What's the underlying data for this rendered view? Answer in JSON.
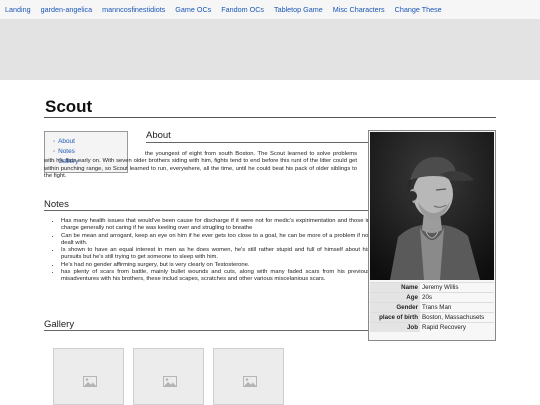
{
  "nav": {
    "links": [
      "Landing",
      "garden-angelica",
      "manncosfinestidiots",
      "Game OCs",
      "Fandom OCs",
      "Tabletop Game",
      "Misc Characters",
      "Change These"
    ]
  },
  "page": {
    "title": "Scout"
  },
  "toc": {
    "items": [
      "About",
      "Notes",
      "Gallery"
    ]
  },
  "about": {
    "heading": "About",
    "text": "the youngest of eight from south Boston. The Scout learned to solve problems with his fists early on. With seven older brothers siding with him, fights tend to end before this runt of the litter could get within punching range, so Scout learned to run, everywhere, all the time, until he could beat his pack of older siblings to the fight."
  },
  "notes": {
    "heading": "Notes",
    "items": [
      "Has many health issues that would've been cause for discharge if it were not for medic's expirimentation and those in charge generally not caring if he was keeling over and strugling to breathe",
      "Can be mean and arrogant, keep an eye on him if he ever gets too close to a goal, he can be more of a problem if not dealt with.",
      "Is shown to have an equal interest in men as he does women, he's still rather stupid and full of himself about his pursuits but he's still trying to get someone to sleep with him.",
      "He's had no gender affirming surgery, but is very clearly on Testosterone.",
      "has plenty of scars from battle, mainly bullet wounds and cuts, along with many faded scars from his previous misadventures with his brothers, these includ scapes, scratches and other various miscelanious scars."
    ]
  },
  "gallery": {
    "heading": "Gallery",
    "items": [
      "image-placeholder-icon",
      "image-placeholder-icon",
      "image-placeholder-icon"
    ]
  },
  "infobox": {
    "rows": [
      {
        "label": "Name",
        "value": "Jeremy Willis"
      },
      {
        "label": "Age",
        "value": "20s"
      },
      {
        "label": "Gender",
        "value": "Trans Man"
      },
      {
        "label": "place of birth",
        "value": "Boston, Massachusets"
      },
      {
        "label": "Job",
        "value": "Rapid Recovery"
      }
    ]
  },
  "colors": {
    "link": "#1a56b8",
    "banner": "#e3e3e3"
  }
}
